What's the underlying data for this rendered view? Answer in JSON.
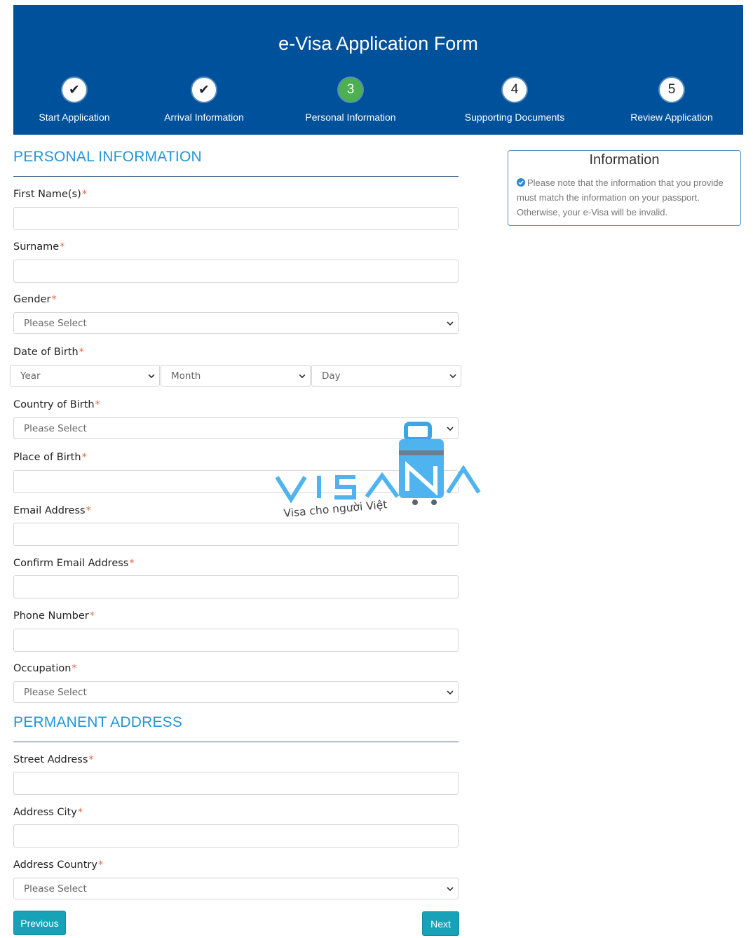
{
  "header": {
    "title": "e-Visa Application Form",
    "steps": [
      {
        "label": "Start Application",
        "symbol": "✔",
        "state": "done"
      },
      {
        "label": "Arrival Information",
        "symbol": "✔",
        "state": "done"
      },
      {
        "label": "Personal Information",
        "symbol": "3",
        "state": "active"
      },
      {
        "label": "Supporting Documents",
        "symbol": "4",
        "state": "pending"
      },
      {
        "label": "Review Application",
        "symbol": "5",
        "state": "pending"
      }
    ]
  },
  "personal": {
    "section_title": "PERSONAL INFORMATION",
    "first_name": {
      "label": "First Name(s)",
      "value": ""
    },
    "surname": {
      "label": "Surname",
      "value": ""
    },
    "gender": {
      "label": "Gender",
      "selected": "Please Select"
    },
    "dob": {
      "label": "Date of Birth",
      "year": "Year",
      "month": "Month",
      "day": "Day"
    },
    "country_of_birth": {
      "label": "Country of Birth",
      "selected": "Please Select"
    },
    "place_of_birth": {
      "label": "Place of Birth",
      "value": ""
    },
    "email": {
      "label": "Email Address",
      "value": ""
    },
    "confirm_email": {
      "label": "Confirm Email Address",
      "value": ""
    },
    "phone": {
      "label": "Phone Number",
      "value": ""
    },
    "occupation": {
      "label": "Occupation",
      "selected": "Please Select"
    }
  },
  "address": {
    "section_title": "PERMANENT ADDRESS",
    "street": {
      "label": "Street Address",
      "value": ""
    },
    "city": {
      "label": "Address City",
      "value": ""
    },
    "country": {
      "label": "Address Country",
      "selected": "Please Select"
    }
  },
  "required_marker": "*",
  "info": {
    "title": "Information",
    "text": "Please note that the information that you provide must match the information on your passport. Otherwise, your e-Visa will be invalid."
  },
  "buttons": {
    "previous": "Previous",
    "next": "Next"
  },
  "watermark": {
    "brand": "VISANA",
    "tagline": "Visa cho người Việt"
  },
  "colors": {
    "header_bg": "#00519b",
    "accent": "#2196d6",
    "active_step": "#4caf50",
    "button": "#17a2b8",
    "required": "#e26a4a"
  }
}
